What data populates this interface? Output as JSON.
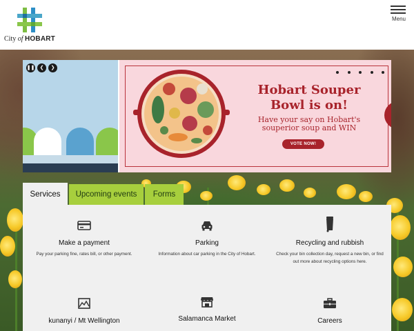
{
  "header": {
    "logo_text_prefix": "City",
    "logo_text_of": "of",
    "logo_text_name": "HOBART",
    "menu_label": "Menu"
  },
  "carousel": {
    "promo_title": "Hobart Souper Bowl is on!",
    "promo_subtitle": "Have your say on Hobart's souperior soup and WIN",
    "vote_button": "VOTE NOW!",
    "controls": {
      "pause": "pause-icon",
      "prev": "chevron-left-icon",
      "next": "chevron-right-icon"
    },
    "slide_count": 5,
    "accent_color": "#a8232b",
    "background_color": "#f9d7dd"
  },
  "tabs": [
    {
      "label": "Services",
      "active": true
    },
    {
      "label": "Upcoming events",
      "active": false
    },
    {
      "label": "Forms",
      "active": false
    }
  ],
  "services": [
    {
      "icon": "credit-card-icon",
      "title": "Make a payment",
      "description": "Pay your parking fine, rates bill, or other payment."
    },
    {
      "icon": "car-icon",
      "title": "Parking",
      "description": "Information about car parking in the City of Hobart."
    },
    {
      "icon": "wheelie-bin-icon",
      "title": "Recycling and rubbish",
      "description": "Check your bin collection day, request a new bin, or find out more about recycling options here."
    },
    {
      "icon": "mountain-map-icon",
      "title": "kunanyi / Mt Wellington",
      "description": ""
    },
    {
      "icon": "market-stall-icon",
      "title": "Salamanca Market",
      "description": ""
    },
    {
      "icon": "briefcase-icon",
      "title": "Careers",
      "description": ""
    }
  ],
  "colors": {
    "tab_inactive": "#a7cf3d",
    "panel": "#f0f0f0"
  }
}
